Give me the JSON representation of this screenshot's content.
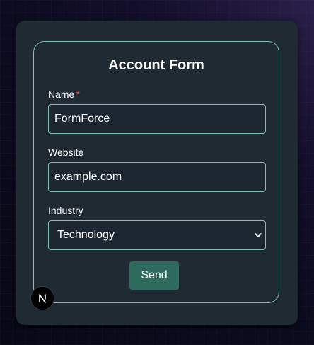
{
  "form": {
    "title": "Account Form",
    "name_label": "Name",
    "required_marker": "*",
    "name_value": "FormForce",
    "website_label": "Website",
    "website_value": "example.com",
    "industry_label": "Industry",
    "industry_selected": "Technology",
    "send_label": "Send"
  },
  "badge": {
    "icon": "nextjs-logo-icon"
  },
  "colors": {
    "accent_border": "#7dbfb0",
    "button_bg": "#2e6b5e",
    "required": "#e05858",
    "card_bg": "#1f2a33"
  }
}
